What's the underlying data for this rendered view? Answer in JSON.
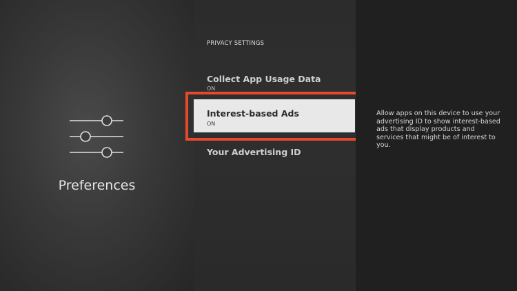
{
  "left": {
    "icon": "sliders-icon",
    "title": "Preferences"
  },
  "middle": {
    "section_title": "PRIVACY SETTINGS",
    "items": [
      {
        "label": "Collect App Usage Data",
        "value": "ON"
      },
      {
        "label": "Interest-based Ads",
        "value": "ON"
      },
      {
        "label": "Your Advertising ID",
        "value": ""
      }
    ],
    "selected": "Interest-based Ads"
  },
  "right": {
    "description": "Allow apps on this device to use your advertising ID to show interest-based ads that display products and services that might be of interest to you."
  },
  "colors": {
    "focus_highlight": "#e8492a",
    "selected_background": "#e8e8e8"
  }
}
